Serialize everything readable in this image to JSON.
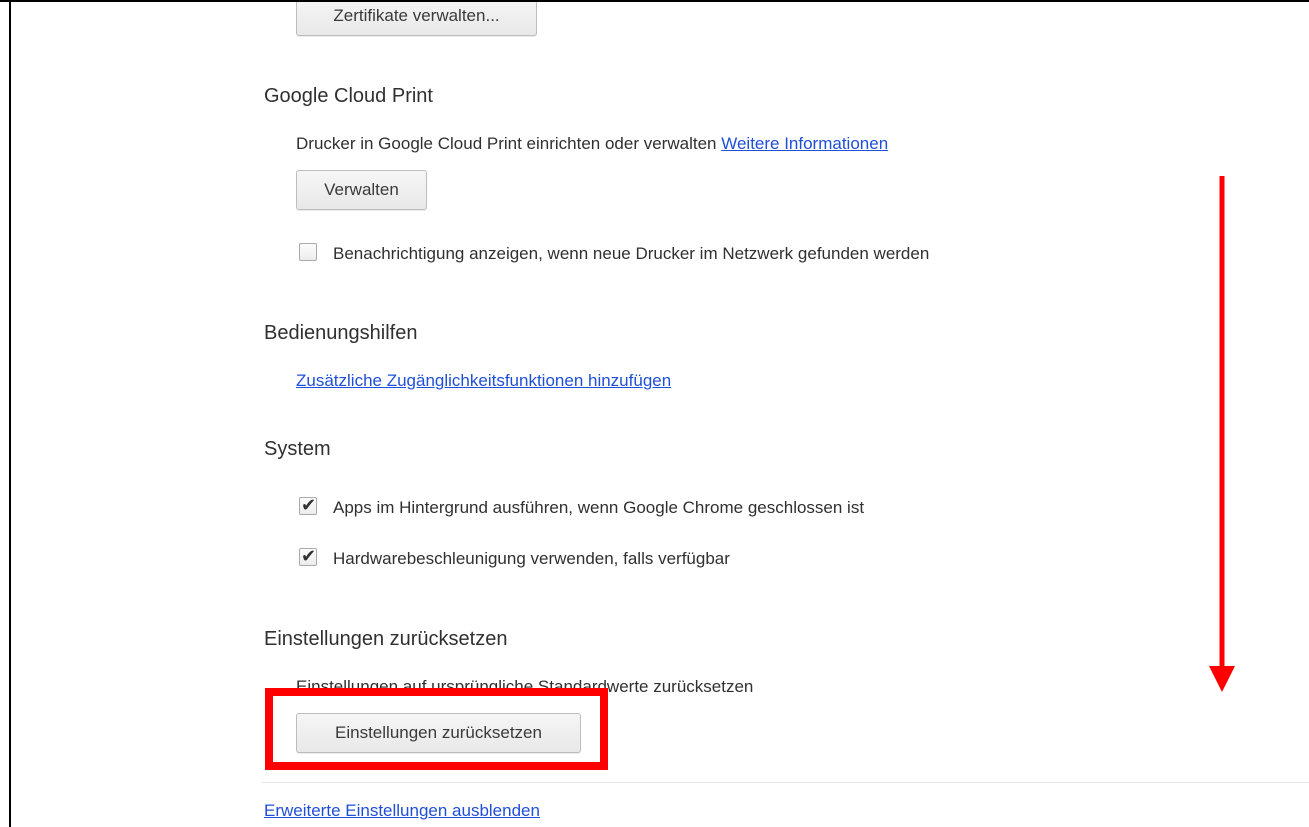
{
  "certificates": {
    "manage_button": "Zertifikate verwalten..."
  },
  "cloud_print": {
    "title": "Google Cloud Print",
    "description": "Drucker in Google Cloud Print einrichten oder verwalten",
    "more_info_link": "Weitere Informationen",
    "manage_button": "Verwalten",
    "notify_checkbox": {
      "label": "Benachrichtigung anzeigen, wenn neue Drucker im Netzwerk gefunden werden",
      "checked": false
    }
  },
  "accessibility": {
    "title": "Bedienungshilfen",
    "add_features_link": "Zusätzliche Zugänglichkeitsfunktionen hinzufügen"
  },
  "system": {
    "title": "System",
    "background_apps": {
      "label": "Apps im Hintergrund ausführen, wenn Google Chrome geschlossen ist",
      "checked": true
    },
    "hardware_accel": {
      "label": "Hardwarebeschleunigung verwenden, falls verfügbar",
      "checked": true
    }
  },
  "reset": {
    "title": "Einstellungen zurücksetzen",
    "description": "Einstellungen auf ursprüngliche Standardwerte zurücksetzen",
    "button": "Einstellungen zurücksetzen"
  },
  "footer": {
    "hide_advanced_link": "Erweiterte Einstellungen ausblenden"
  },
  "annotations": {
    "color": "#ff0000",
    "arrow_direction": "down"
  }
}
